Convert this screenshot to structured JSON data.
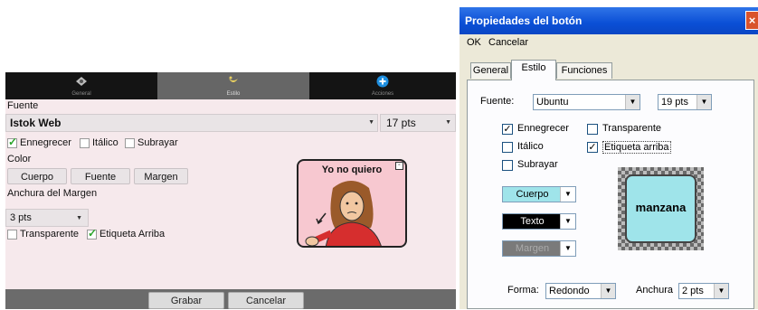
{
  "android": {
    "tabs": [
      {
        "label": "General",
        "icon": "general-icon"
      },
      {
        "label": "Estilo",
        "icon": "style-icon"
      },
      {
        "label": "Acciones",
        "icon": "add-icon"
      }
    ],
    "font_heading": "Fuente",
    "font_value": "Istok Web",
    "font_size": "17 pts",
    "checkboxes": {
      "bold": "Ennegrecer",
      "italic": "Itálico",
      "underline": "Subrayar"
    },
    "color_heading": "Color",
    "color_buttons": {
      "body": "Cuerpo",
      "font": "Fuente",
      "margin": "Margen"
    },
    "margin_heading": "Anchura del Margen",
    "margin_value": "3 pts",
    "transparent": "Transparente",
    "label_top": "Etiqueta Arriba",
    "preview_label": "Yo no quiero",
    "save": "Grabar",
    "cancel": "Cancelar",
    "colors": {
      "preview_bg": "#f7c8d0",
      "check": "#2aa52a"
    }
  },
  "dialog": {
    "title": "Propiedades del botón",
    "menu": {
      "ok": "OK",
      "cancel": "Cancelar"
    },
    "tabs": [
      "General",
      "Estilo",
      "Funciones"
    ],
    "font_label": "Fuente:",
    "font_value": "Ubuntu",
    "size_value": "19 pts",
    "checkboxes": {
      "bold": "Ennegrecer",
      "transparent": "Transparente",
      "italic": "Itálico",
      "label_top": "Etiqueta arriba",
      "underline": "Subrayar"
    },
    "color_body": "Cuerpo",
    "color_text": "Texto",
    "color_margin": "Margen",
    "preview_text": "manzana",
    "shape_label": "Forma:",
    "shape_value": "Redondo",
    "width_label": "Anchura",
    "width_value": "2 pts",
    "colors": {
      "body": "#9fe4ea",
      "text_bg": "#000000",
      "margin_bg": "#7a7a7a",
      "title": "#0a4fd6"
    }
  }
}
